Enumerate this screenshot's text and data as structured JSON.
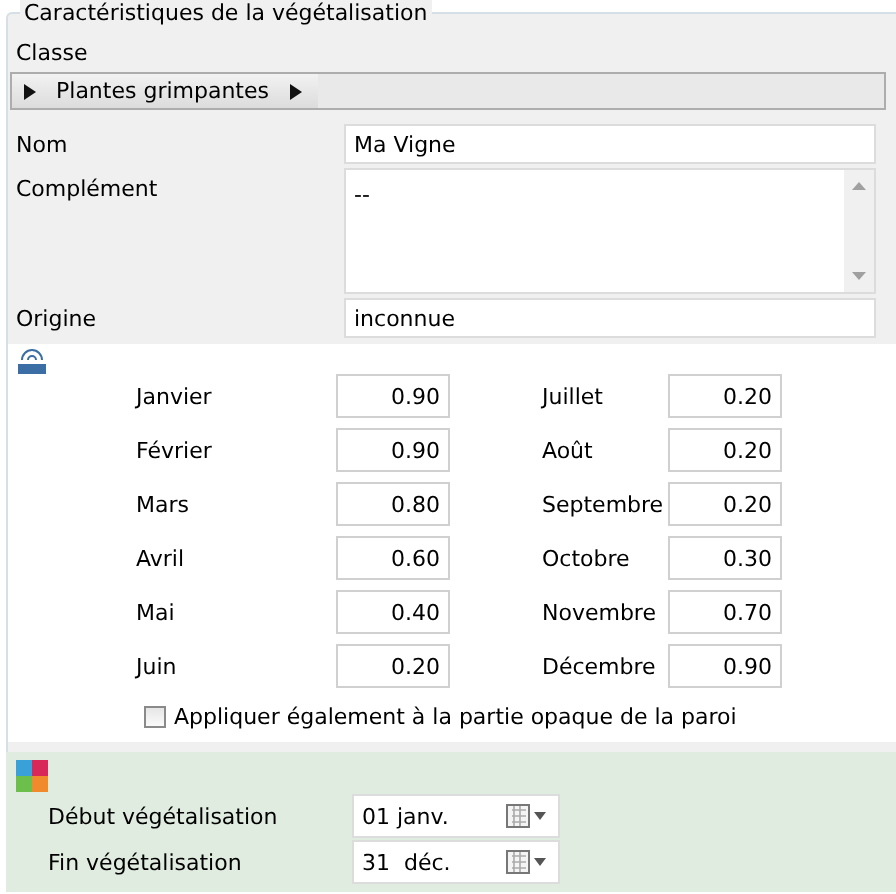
{
  "group": {
    "title": "Caractéristiques de la végétalisation"
  },
  "classe": {
    "label": "Classe",
    "path": [
      {
        "label": "Plantes grimpantes"
      }
    ]
  },
  "fields": [
    {
      "label": "Nom",
      "value": "Ma Vigne",
      "kind": "text"
    },
    {
      "label": "Complément",
      "value": "--",
      "kind": "multiline"
    },
    {
      "label": "Origine",
      "value": "inconnue",
      "kind": "text"
    }
  ],
  "months_left": [
    {
      "label": "Janvier",
      "value": "0.90"
    },
    {
      "label": "Février",
      "value": "0.90"
    },
    {
      "label": "Mars",
      "value": "0.80"
    },
    {
      "label": "Avril",
      "value": "0.60"
    },
    {
      "label": "Mai",
      "value": "0.40"
    },
    {
      "label": "Juin",
      "value": "0.20"
    }
  ],
  "months_right": [
    {
      "label": "Juillet",
      "value": "0.20"
    },
    {
      "label": "Août",
      "value": "0.20"
    },
    {
      "label": "Septembre",
      "value": "0.20"
    },
    {
      "label": "Octobre",
      "value": "0.30"
    },
    {
      "label": "Novembre",
      "value": "0.70"
    },
    {
      "label": "Décembre",
      "value": "0.90"
    }
  ],
  "apply_opaque": {
    "label": "Appliquer également à la partie opaque de la paroi",
    "checked": false
  },
  "dates": [
    {
      "label": "Début végétalisation",
      "value": "01 janv."
    },
    {
      "label": "Fin végétalisation",
      "value": "31  déc."
    }
  ]
}
